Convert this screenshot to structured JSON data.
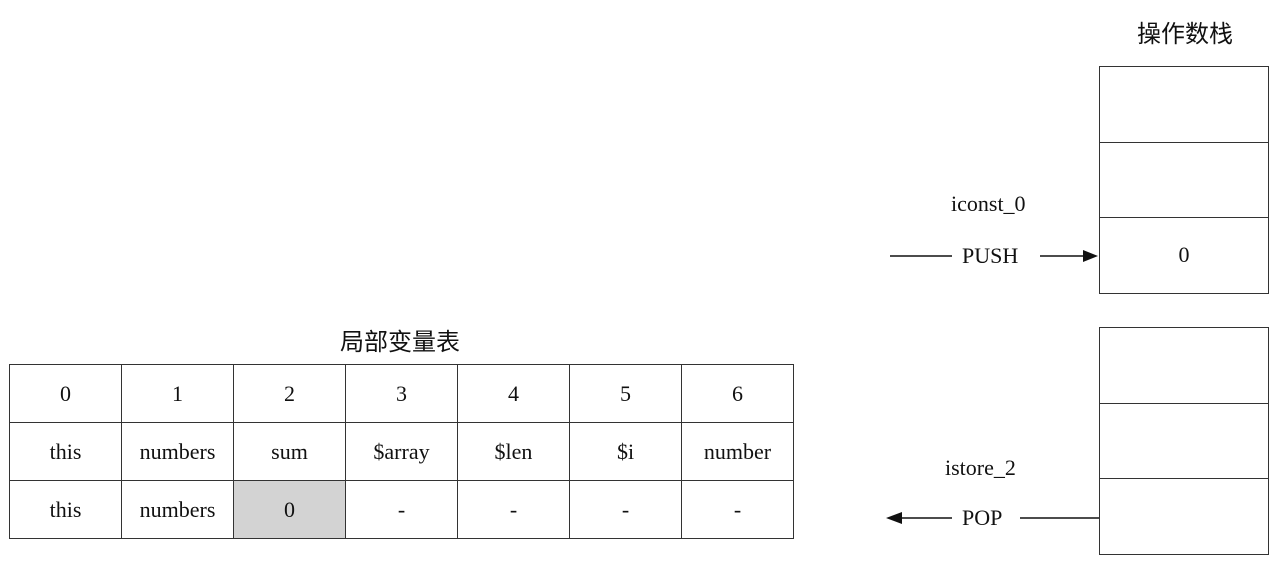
{
  "local_variable_table": {
    "title": "局部变量表",
    "indices": [
      "0",
      "1",
      "2",
      "3",
      "4",
      "5",
      "6"
    ],
    "names": [
      "this",
      "numbers",
      "sum",
      "$array",
      "$len",
      "$i",
      "number"
    ],
    "values": [
      "this",
      "numbers",
      "0",
      "-",
      "-",
      "-",
      "-"
    ],
    "highlighted_index": 2,
    "highlight_color": "#d3d3d3"
  },
  "operand_stack": {
    "title": "操作数栈",
    "before": [
      "",
      "",
      "0"
    ],
    "after": [
      "",
      "",
      ""
    ]
  },
  "instructions": {
    "first": {
      "name": "iconst_0",
      "action": "PUSH"
    },
    "second": {
      "name": "istore_2",
      "action": "POP"
    }
  }
}
